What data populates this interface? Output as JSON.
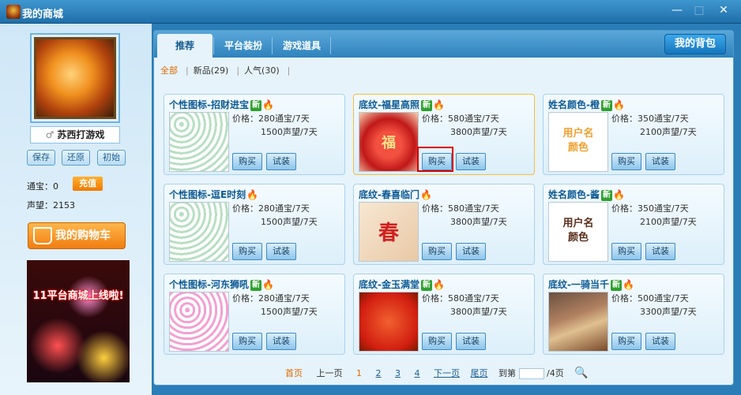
{
  "window": {
    "title": "我的商城",
    "min_label": "—",
    "max_label": "□",
    "close_label": "✕"
  },
  "left": {
    "username": "苏西打游戏",
    "buttons": [
      "保存",
      "还原",
      "初始"
    ],
    "coins_label": "通宝：0",
    "recharge_label": "充值",
    "fame_label": "声望：2153",
    "cart_label": "我的购物车",
    "banner_text": "11平台商城上线啦!"
  },
  "tabs": [
    {
      "label": "推荐",
      "active": true
    },
    {
      "label": "平台装扮",
      "active": false
    },
    {
      "label": "游戏道具",
      "active": false
    }
  ],
  "bag_label": "我的背包",
  "filters": [
    {
      "label": "全部",
      "active": true
    },
    {
      "label": "新品(29)",
      "active": false
    },
    {
      "label": "人气(30)",
      "active": false
    }
  ],
  "products": [
    {
      "title": "个性图标-招财进宝",
      "thumb_text": "",
      "price": "价格：280通宝/7天",
      "price2": "1500声望/7天",
      "buy": "购买",
      "try": "试装",
      "selected": false
    },
    {
      "title": "底纹-福星高照",
      "thumb_text": "福",
      "price": "价格：580通宝/7天",
      "price2": "3800声望/7天",
      "buy": "购买",
      "try": "试装",
      "selected": true
    },
    {
      "title": "姓名颜色-橙",
      "thumb_text": "用户名\n颜色",
      "price": "价格：350通宝/7天",
      "price2": "2100声望/7天",
      "buy": "购买",
      "try": "试装",
      "selected": false
    },
    {
      "title": "个性图标-逗E时刻",
      "thumb_text": "",
      "price": "价格：280通宝/7天",
      "price2": "1500声望/7天",
      "buy": "购买",
      "try": "试装",
      "selected": false
    },
    {
      "title": "底纹-春喜临门",
      "thumb_text": "春",
      "price": "价格：580通宝/7天",
      "price2": "3800声望/7天",
      "buy": "购买",
      "try": "试装",
      "selected": false
    },
    {
      "title": "姓名颜色-酱",
      "thumb_text": "用户名\n颜色",
      "price": "价格：350通宝/7天",
      "price2": "2100声望/7天",
      "buy": "购买",
      "try": "试装",
      "selected": false
    },
    {
      "title": "个性图标-河东狮吼",
      "thumb_text": "",
      "price": "价格：280通宝/7天",
      "price2": "1500声望/7天",
      "buy": "购买",
      "try": "试装",
      "selected": false
    },
    {
      "title": "底纹-金玉满堂",
      "thumb_text": "",
      "price": "价格：580通宝/7天",
      "price2": "3800声望/7天",
      "buy": "购买",
      "try": "试装",
      "selected": false
    },
    {
      "title": "底纹-一骑当千",
      "thumb_text": "",
      "price": "价格：500通宝/7天",
      "price2": "3300声望/7天",
      "buy": "购买",
      "try": "试装",
      "selected": false
    }
  ],
  "new_badge": "新",
  "pager": {
    "first": "首页",
    "prev": "上一页",
    "pages": [
      "1",
      "2",
      "3",
      "4"
    ],
    "current": "1",
    "next": "下一页",
    "last": "尾页",
    "goto_label": "到第",
    "total_label": "/4页"
  }
}
